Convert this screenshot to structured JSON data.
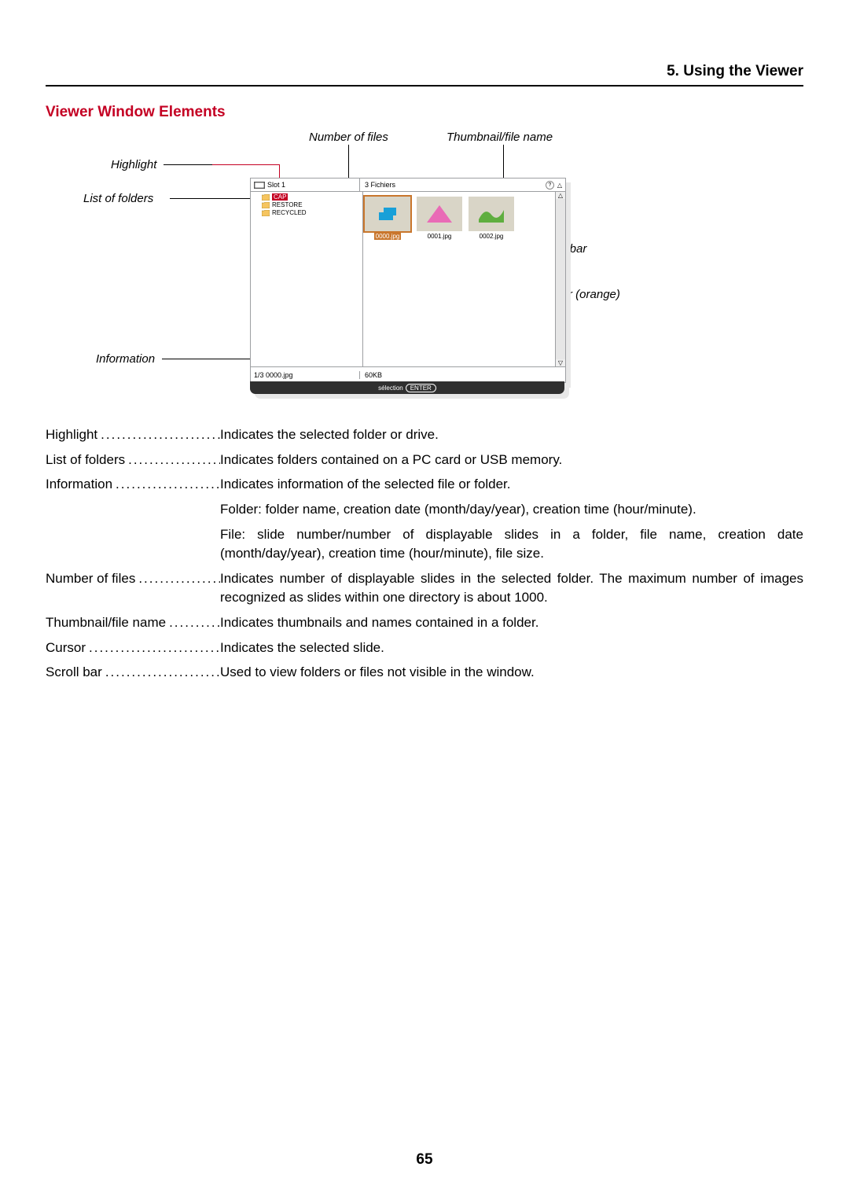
{
  "chapter": "5. Using the Viewer",
  "section_title": "Viewer Window Elements",
  "page_number": "65",
  "annotations": {
    "number_of_files": "Number of files",
    "thumbnail_file_name": "Thumbnail/file name",
    "highlight": "Highlight",
    "list_of_folders": "List of folders",
    "information": "Information",
    "scroll_bar": "Scroll bar",
    "cursor_orange": "Cursor (orange)"
  },
  "viewer": {
    "slot_label": "Slot 1",
    "files_count_label": "3 Fichiers",
    "folders": [
      {
        "name": "CAP",
        "highlighted": true
      },
      {
        "name": "RESTORE",
        "highlighted": false
      },
      {
        "name": "RECYCLED",
        "highlighted": false
      }
    ],
    "thumbnails": [
      {
        "name": "0000.jpg",
        "selected": true,
        "shape": "blue"
      },
      {
        "name": "0001.jpg",
        "selected": false,
        "shape": "pink"
      },
      {
        "name": "0002.jpg",
        "selected": false,
        "shape": "green"
      }
    ],
    "info_left": "1/3  0000.jpg",
    "info_mid": "60KB",
    "status_label": "sélection",
    "status_button": "ENTER"
  },
  "definitions": [
    {
      "term": "Highlight",
      "desc": "Indicates the selected folder or drive."
    },
    {
      "term": "List of folders",
      "desc": "Indicates folders contained on a PC card or USB memory."
    },
    {
      "term": "Information",
      "desc": "Indicates information of the selected file or folder."
    },
    {
      "term": "",
      "desc": "Folder: folder name, creation date (month/day/year), creation time (hour/minute)."
    },
    {
      "term": "",
      "desc": "File: slide number/number of displayable slides in a folder, file name, creation date (month/day/year), creation time (hour/minute), file size."
    },
    {
      "term": "Number of files",
      "desc": "Indicates number of displayable slides in the selected folder. The maximum number of images recognized as slides within one directory is about 1000."
    },
    {
      "term": "Thumbnail/file name",
      "desc": "Indicates thumbnails and names contained in a folder."
    },
    {
      "term": "Cursor",
      "desc": "Indicates the selected slide."
    },
    {
      "term": "Scroll bar",
      "desc": "Used to view folders or files not visible in the window."
    }
  ]
}
